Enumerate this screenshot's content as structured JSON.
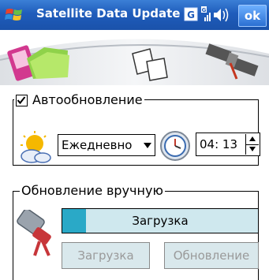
{
  "titlebar": {
    "title": "Satellite Data Update",
    "ok_label": "ok",
    "status_icons": [
      "gps-icon",
      "signal-icon",
      "volume-icon"
    ]
  },
  "auto_update": {
    "label": "Автообновление",
    "checked": true,
    "frequency": "Ежедневно",
    "time": "04: 13"
  },
  "manual_update": {
    "label": "Обновление вручную",
    "progress_text": "Загрузка",
    "progress_fraction": 0.12,
    "download_button": "Загрузка",
    "update_button": "Обновление"
  },
  "colors": {
    "titlebar": "#1f5cbb",
    "progress_fill": "#2aa9c7",
    "progress_track": "#cfe8ee"
  }
}
